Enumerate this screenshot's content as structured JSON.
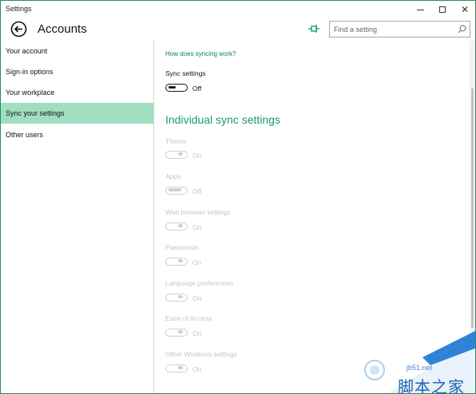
{
  "window": {
    "title": "Settings"
  },
  "header": {
    "title": "Accounts",
    "search_placeholder": "Find a setting"
  },
  "sidebar": {
    "items": [
      {
        "label": "Your account",
        "active": false
      },
      {
        "label": "Sign-in options",
        "active": false
      },
      {
        "label": "Your workplace",
        "active": false
      },
      {
        "label": "Sync your settings",
        "active": true
      },
      {
        "label": "Other users",
        "active": false
      }
    ]
  },
  "main": {
    "help_link": "How does syncing work?",
    "sync_settings": {
      "label": "Sync settings",
      "state": "Off"
    },
    "section_title": "Individual sync settings",
    "individual": [
      {
        "label": "Theme",
        "state": "On"
      },
      {
        "label": "Apps",
        "state": "Off"
      },
      {
        "label": "Web browser settings",
        "state": "On"
      },
      {
        "label": "Passwords",
        "state": "On"
      },
      {
        "label": "Language preferences",
        "state": "On"
      },
      {
        "label": "Ease of Access",
        "state": "On"
      },
      {
        "label": "Other Windows settings",
        "state": "On"
      }
    ]
  },
  "watermark": {
    "site": "jb51.net",
    "text": "脚本之家"
  },
  "colors": {
    "accent": "#1a9c68",
    "active_nav": "#a0dec0",
    "link": "#10834d",
    "disabled": "#c5c5c5"
  },
  "icons": {
    "back": "back-arrow-icon",
    "pin": "pin-icon",
    "search": "search-icon"
  }
}
